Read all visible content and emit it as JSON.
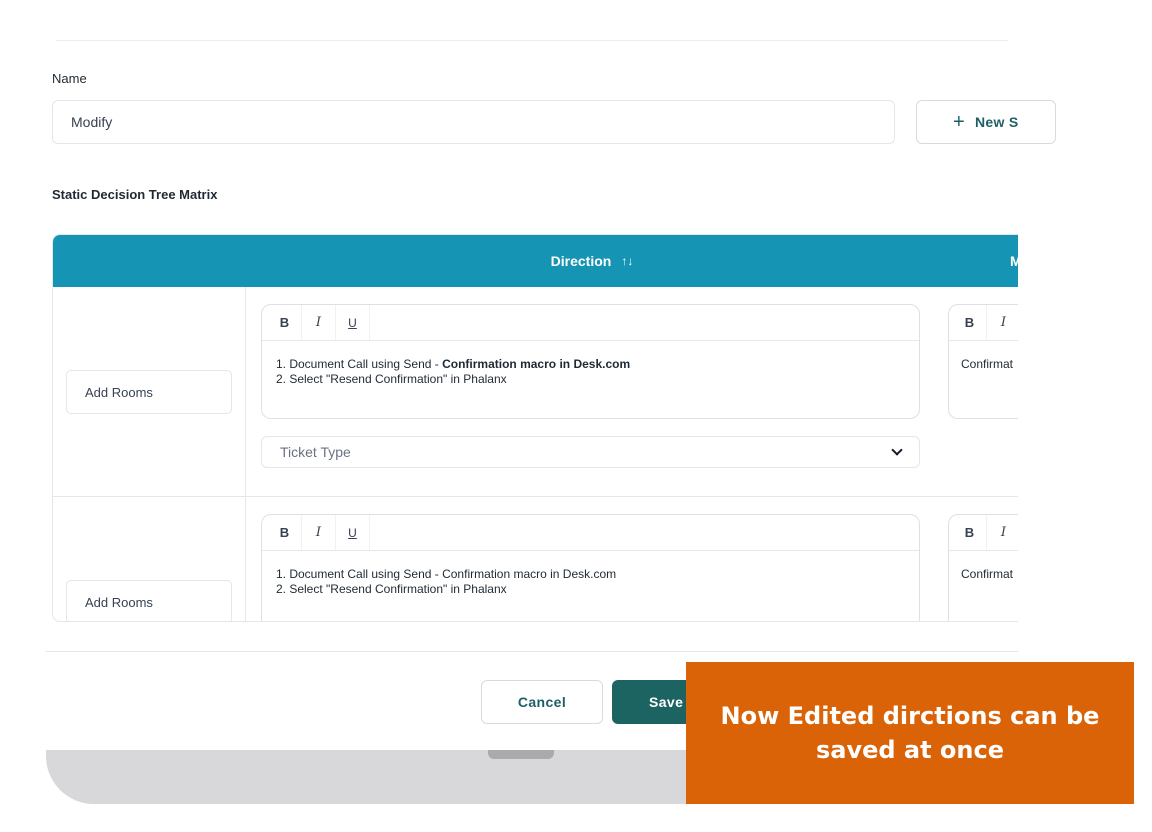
{
  "form": {
    "name_label": "Name",
    "name_value": "Modify",
    "new_button_label": "New S",
    "matrix_title": "Static Decision Tree Matrix"
  },
  "table": {
    "columns": [
      {
        "label": "Direction",
        "sort_icon": "sort-arrows-icon"
      },
      {
        "label": "M"
      }
    ],
    "rows": [
      {
        "add_rooms_label": "Add Rooms",
        "direction_line1_prefix": "1. Document Call using Send - ",
        "direction_line1_emphasis": "Confirmation macro in Desk.com",
        "direction_line2": "2. Select \"Resend Confirmation\" in Phalanx",
        "second_cell_text": "Confirmat",
        "ticket_type_placeholder": "Ticket Type"
      },
      {
        "add_rooms_label": "Add Rooms",
        "direction_line1_prefix": "1. Document Call using Send - ",
        "direction_line1_emphasis": "Confirmation macro in Desk.com",
        "direction_line2": "2. Select \"Resend Confirmation\" in Phalanx",
        "second_cell_text": "Confirmat"
      }
    ],
    "toolbar": {
      "bold": "B",
      "italic": "I",
      "underline": "U"
    },
    "header_color": "#1595b3"
  },
  "actions": {
    "cancel_label": "Cancel",
    "save_label": "Save"
  },
  "callout": {
    "text": "Now Edited dirctions can be saved at once",
    "color": "#d96306"
  }
}
